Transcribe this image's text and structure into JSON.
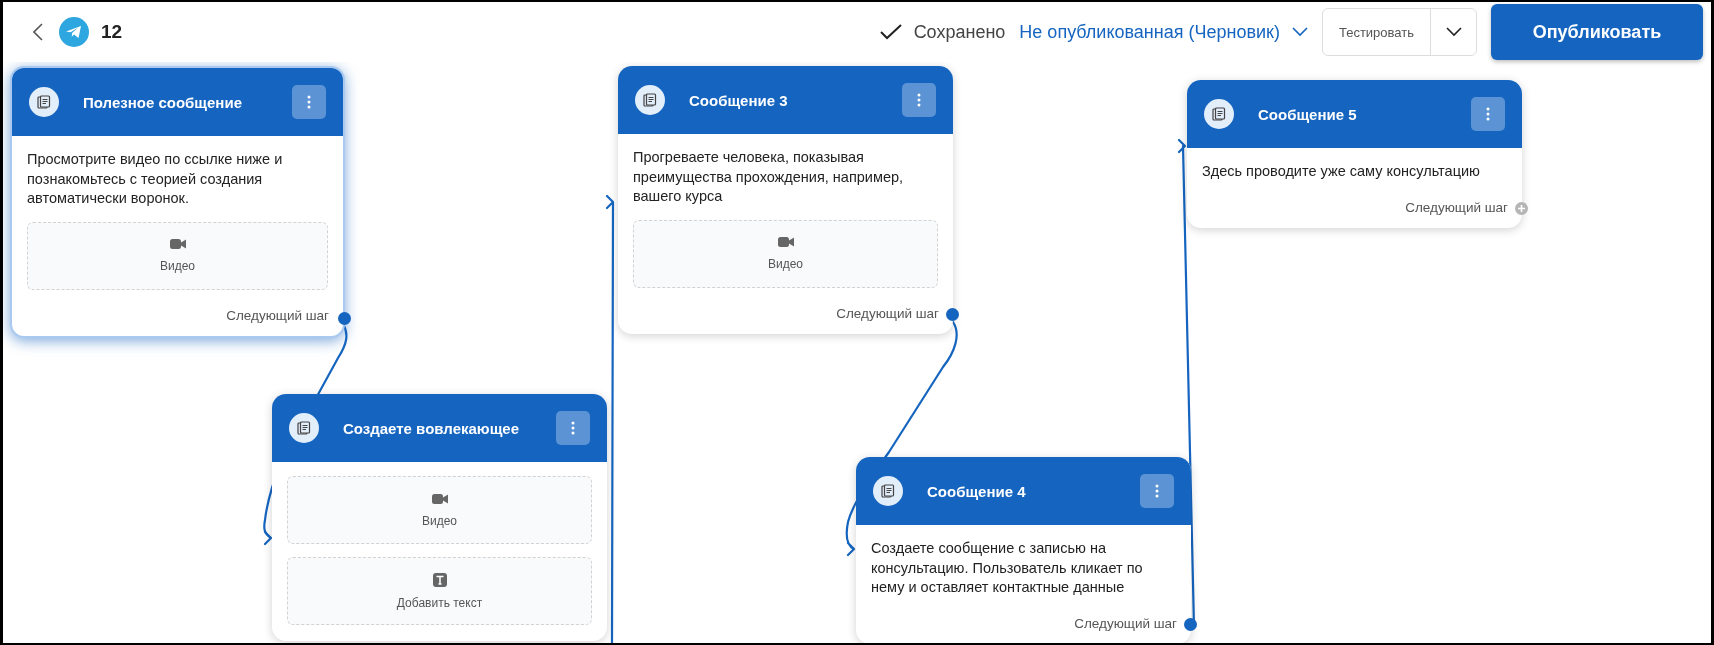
{
  "header": {
    "bot_count": "12",
    "save_status": "Сохранено",
    "publish_state": "Не опубликованная (Черновик)",
    "test_button": "Тестировать",
    "publish_button": "Опубликовать"
  },
  "cards": [
    {
      "title": "Полезное сообщение",
      "selected": true,
      "content": [
        {
          "kind": "text",
          "text": "Просмотрите видео по ссылке ниже и познакомьтесь с теорией создания автоматически воронок."
        },
        {
          "kind": "video",
          "label": "Видео"
        }
      ],
      "next_step": {
        "label": "Следующий шаг",
        "connected": true
      }
    },
    {
      "title": "Создаете вовлекающее",
      "selected": false,
      "content": [
        {
          "kind": "video",
          "label": "Видео"
        },
        {
          "kind": "add_text",
          "label": "Добавить текст"
        }
      ]
    },
    {
      "title": "Сообщение 3",
      "selected": false,
      "content": [
        {
          "kind": "text",
          "text": "Прогреваете человека, показывая преимущества прохождения, например, вашего курса"
        },
        {
          "kind": "video",
          "label": "Видео"
        }
      ],
      "next_step": {
        "label": "Следующий шаг",
        "connected": true
      }
    },
    {
      "title": "Сообщение 4",
      "selected": false,
      "content": [
        {
          "kind": "text",
          "text": "Создаете сообщение с записью на консультацию. Пользователь кликает по нему и оставляет контактные данные"
        }
      ],
      "next_step": {
        "label": "Следующий шаг",
        "connected": true
      }
    },
    {
      "title": "Сообщение 5",
      "selected": false,
      "content": [
        {
          "kind": "text",
          "text": "Здесь проводите уже саму консультацию"
        }
      ],
      "next_step": {
        "label": "Следующий шаг",
        "connected": false
      }
    }
  ]
}
